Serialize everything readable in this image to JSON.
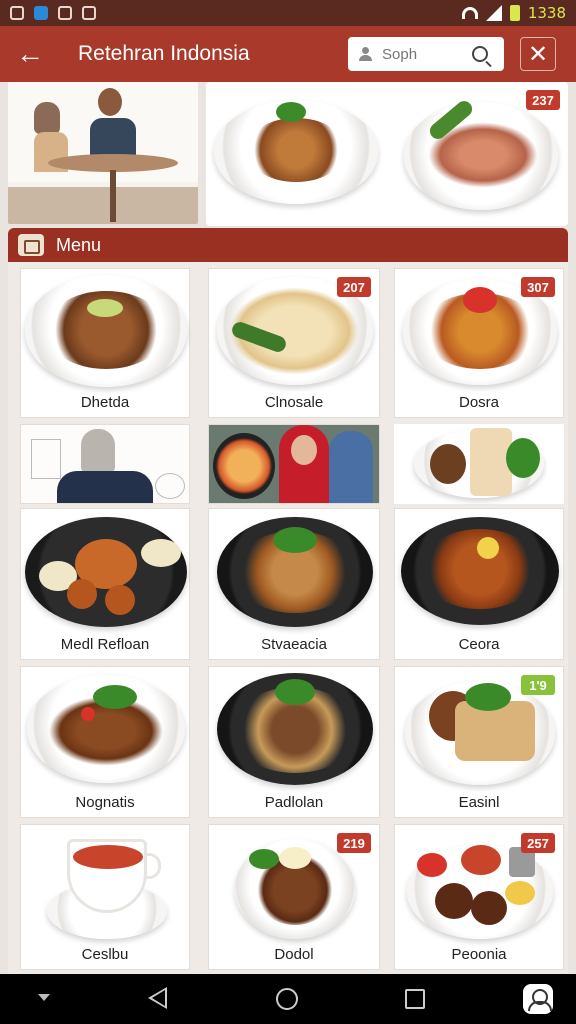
{
  "status_bar": {
    "time": "1338",
    "icons": [
      "notification-icon",
      "app-icon",
      "shield-icon",
      "image-icon",
      "wifi-icon",
      "signal-icon",
      "battery-icon"
    ]
  },
  "app_bar": {
    "title": "Retehran Indonsia",
    "search_placeholder": "Soph",
    "back_icon": "arrow-left-icon",
    "close_icon": "close-icon"
  },
  "hero": {
    "badge": "237"
  },
  "menu": {
    "title": "Menu",
    "items": [
      {
        "label": "Dhetda",
        "badge": ""
      },
      {
        "label": "Clnosale",
        "badge": "207"
      },
      {
        "label": "Dosra",
        "badge": "307"
      },
      {
        "label": "Medl Refloan",
        "badge": ""
      },
      {
        "label": "Stvaeacia",
        "badge": ""
      },
      {
        "label": "Ceora",
        "badge": ""
      },
      {
        "label": "Nognatis",
        "badge": ""
      },
      {
        "label": "Padlolan",
        "badge": ""
      },
      {
        "label": "Easinl",
        "badge": "1'9"
      },
      {
        "label": "Ceslbu",
        "badge": ""
      },
      {
        "label": "Dodol",
        "badge": "219"
      },
      {
        "label": "Peoonia",
        "badge": "257"
      }
    ]
  },
  "colors": {
    "app_bar": "#a8392b",
    "status_bar": "#5a2a21",
    "menu_header": "#9a3021",
    "badge_red": "#c23a2b",
    "badge_green": "#87c23a"
  }
}
